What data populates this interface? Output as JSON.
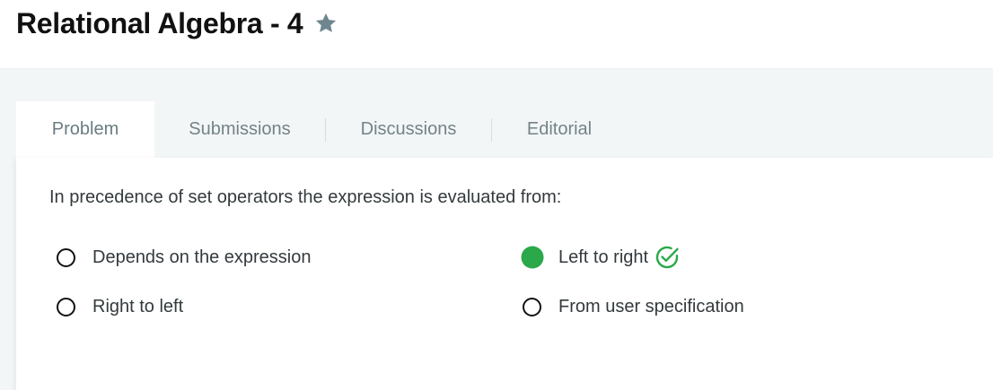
{
  "header": {
    "title": "Relational Algebra - 4",
    "star_icon": "star-icon",
    "star_color": "#6f8690"
  },
  "tabs": [
    {
      "label": "Problem",
      "active": true
    },
    {
      "label": "Submissions",
      "active": false
    },
    {
      "label": "Discussions",
      "active": false
    },
    {
      "label": "Editorial",
      "active": false
    }
  ],
  "question": {
    "text": "In precedence of set operators the expression is evaluated from:",
    "options": [
      {
        "label": "Depends on the expression",
        "selected": false,
        "correct": false
      },
      {
        "label": "Left to right",
        "selected": true,
        "correct": true
      },
      {
        "label": "Right to left",
        "selected": false,
        "correct": false
      },
      {
        "label": "From user specification",
        "selected": false,
        "correct": false
      }
    ]
  },
  "colors": {
    "correct": "#2aa84a",
    "tab_text": "#738388",
    "band": "#f3f6f7"
  },
  "icons": {
    "correct_icon": "check-circle-icon"
  }
}
